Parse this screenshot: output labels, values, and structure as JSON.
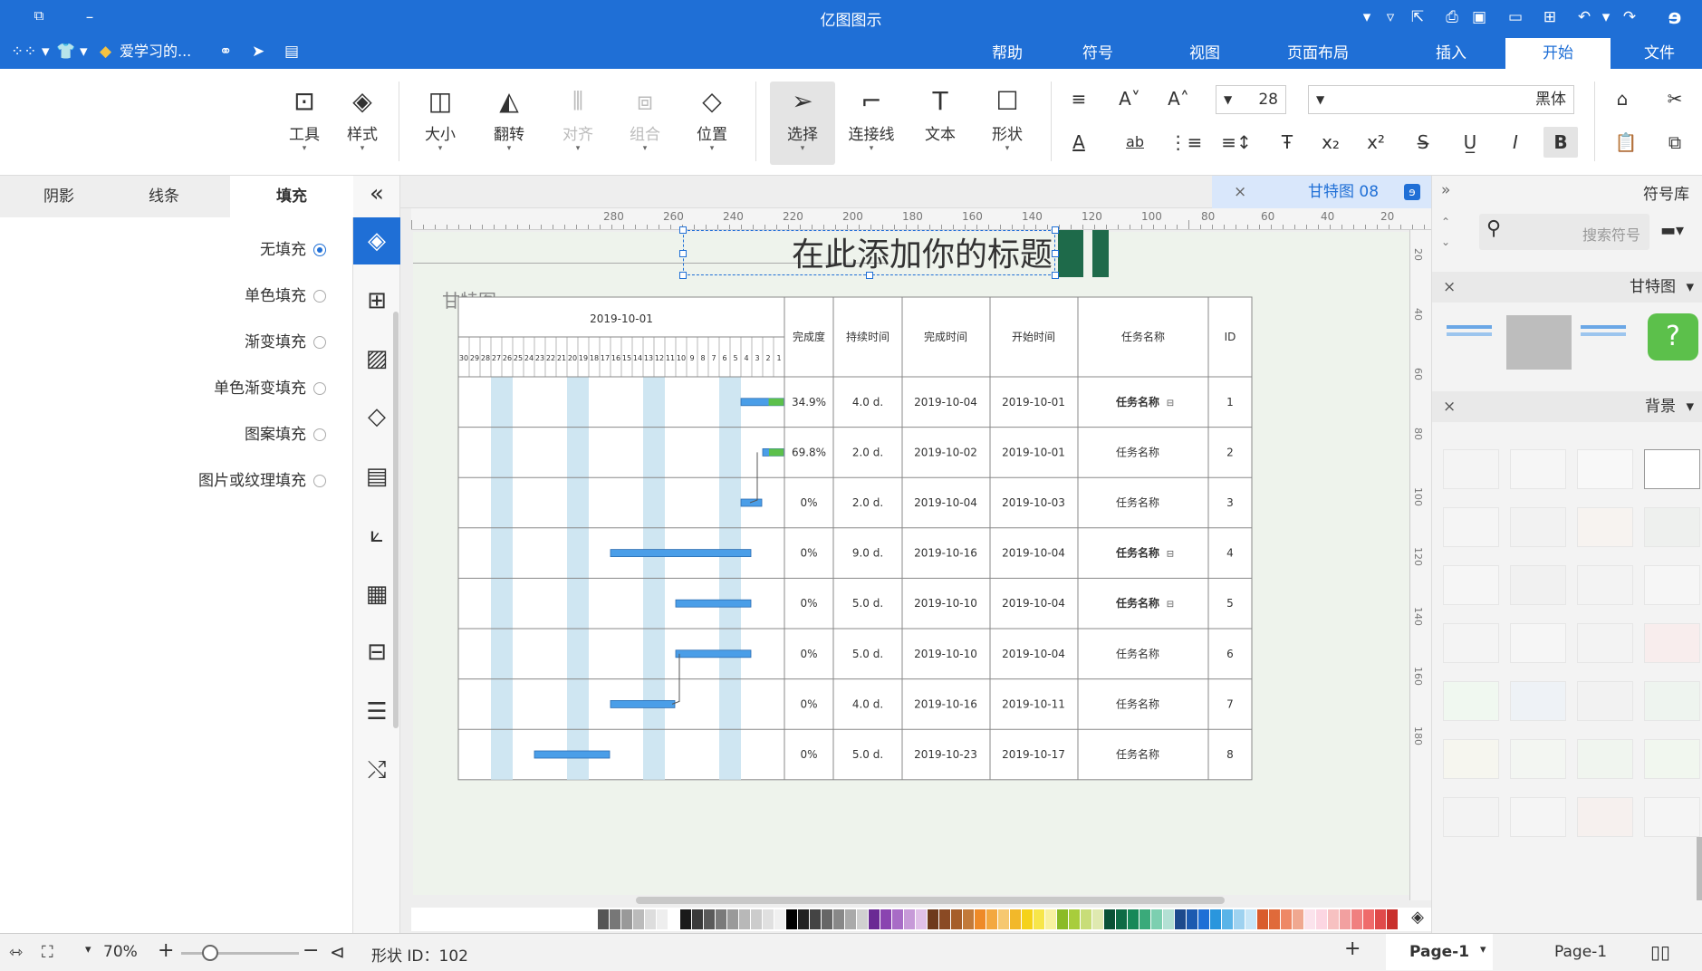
{
  "window": {
    "title": "亿图图示"
  },
  "menu": {
    "tabs": [
      "文件",
      "开始",
      "插入",
      "页面布局",
      "视图",
      "符号",
      "帮助"
    ],
    "active_tab": "开始",
    "user_label": "爱学习的..."
  },
  "toolbar": {
    "font_name": "黑体",
    "font_size": "28",
    "tools": [
      {
        "label": "形状",
        "icon": "square-icon"
      },
      {
        "label": "文本",
        "icon": "text-icon"
      },
      {
        "label": "连接线",
        "icon": "connector-icon"
      },
      {
        "label": "选择",
        "icon": "cursor-icon"
      },
      {
        "label": "位置",
        "icon": "layers-icon"
      },
      {
        "label": "组合",
        "icon": "group-icon"
      },
      {
        "label": "对齐",
        "icon": "align-icon"
      },
      {
        "label": "翻转",
        "icon": "flip-icon"
      },
      {
        "label": "大小",
        "icon": "size-icon"
      },
      {
        "label": "样式",
        "icon": "paint-icon"
      },
      {
        "label": "工具",
        "icon": "tools-icon"
      }
    ]
  },
  "left_panel": {
    "tabs": [
      "填充",
      "线条",
      "阴影"
    ],
    "active_tab": "填充",
    "fill_options": [
      "无填充",
      "单色填充",
      "渐变填充",
      "单色渐变填充",
      "图案填充",
      "图片或纹理填充"
    ],
    "selected_fill": "无填充"
  },
  "document": {
    "tab_name": "甘特图 08",
    "heading": "在此添加你的标题",
    "subheading": "甘特图",
    "ruler_h": [
      "20",
      "40",
      "60",
      "80",
      "100",
      "120",
      "140",
      "160",
      "180",
      "200",
      "220",
      "240",
      "260",
      "280"
    ],
    "ruler_v": [
      "20",
      "40",
      "60",
      "80",
      "100",
      "120",
      "140",
      "160",
      "180"
    ]
  },
  "gantt": {
    "headers": [
      "ID",
      "任务名称",
      "开始时间",
      "完成时间",
      "持续时间",
      "完成度"
    ],
    "month_label": "2019-10-01",
    "days": [
      "1",
      "2",
      "3",
      "4",
      "5",
      "6",
      "7",
      "8",
      "9",
      "10",
      "11",
      "12",
      "13",
      "14",
      "15",
      "16",
      "17",
      "18",
      "19",
      "20",
      "21",
      "22",
      "23",
      "24",
      "25",
      "26",
      "27",
      "28",
      "29",
      "30"
    ],
    "rows": [
      {
        "id": "1",
        "name": "任务名称",
        "start": "2019-10-01",
        "end": "2019-10-04",
        "dur": "4.0 d.",
        "pct": "34.9%",
        "bold": true,
        "bar_start": 1,
        "bar_days": 4,
        "progress": 0.349
      },
      {
        "id": "2",
        "name": "任务名称",
        "start": "2019-10-01",
        "end": "2019-10-02",
        "dur": "2.0 d.",
        "pct": "69.8%",
        "bold": false,
        "bar_start": 1,
        "bar_days": 2,
        "progress": 0.698
      },
      {
        "id": "3",
        "name": "任务名称",
        "start": "2019-10-03",
        "end": "2019-10-04",
        "dur": "2.0 d.",
        "pct": "0%",
        "bold": false,
        "bar_start": 3,
        "bar_days": 2,
        "progress": 0
      },
      {
        "id": "4",
        "name": "任务名称",
        "start": "2019-10-04",
        "end": "2019-10-16",
        "dur": "9.0 d.",
        "pct": "0%",
        "bold": true,
        "bar_start": 4,
        "bar_days": 13,
        "progress": 0
      },
      {
        "id": "5",
        "name": "任务名称",
        "start": "2019-10-04",
        "end": "2019-10-10",
        "dur": "5.0 d.",
        "pct": "0%",
        "bold": true,
        "bar_start": 4,
        "bar_days": 7,
        "progress": 0
      },
      {
        "id": "6",
        "name": "任务名称",
        "start": "2019-10-04",
        "end": "2019-10-10",
        "dur": "5.0 d.",
        "pct": "0%",
        "bold": false,
        "bar_start": 4,
        "bar_days": 7,
        "progress": 0
      },
      {
        "id": "7",
        "name": "任务名称",
        "start": "2019-10-11",
        "end": "2019-10-16",
        "dur": "4.0 d.",
        "pct": "0%",
        "bold": false,
        "bar_start": 11,
        "bar_days": 6,
        "progress": 0
      },
      {
        "id": "8",
        "name": "任务名称",
        "start": "2019-10-17",
        "end": "2019-10-23",
        "dur": "5.0 d.",
        "pct": "0%",
        "bold": false,
        "bar_start": 17,
        "bar_days": 7,
        "progress": 0
      }
    ],
    "weekend_starts": [
      5,
      12,
      19,
      26
    ]
  },
  "right_panel": {
    "title": "符号库",
    "search_placeholder": "搜索符号",
    "categories": [
      "甘特图",
      "背景"
    ]
  },
  "status": {
    "page_label": "Page-1",
    "page_tab": "Page-1",
    "shape_id": "形状 ID：102",
    "zoom": "70%",
    "zoom_level": 0.7
  },
  "colors": {
    "accent": "#1f6fd6",
    "bar": "#4a9ee8",
    "progress": "#5cc04b",
    "weekend": "#cfe6f2"
  }
}
